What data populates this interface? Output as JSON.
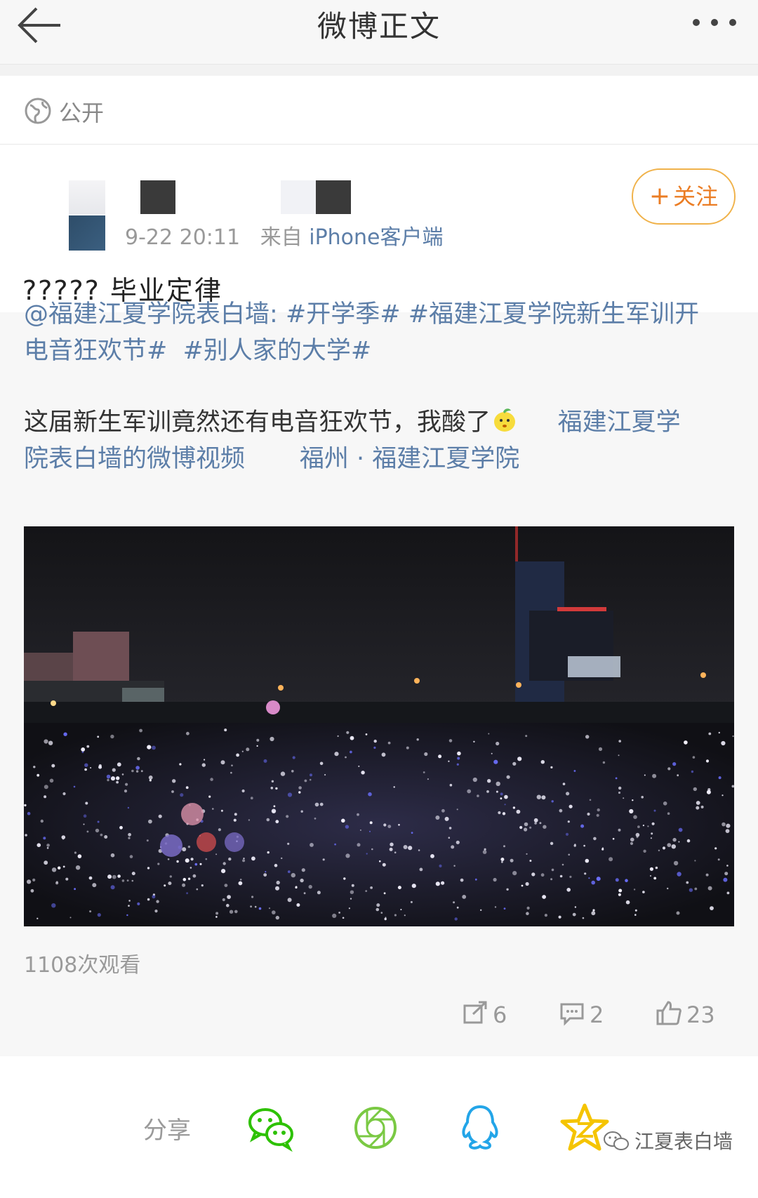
{
  "header": {
    "title": "微博正文",
    "back_icon": "arrow-left-icon",
    "more_icon": "more-dots-icon"
  },
  "visibility": {
    "icon": "globe-icon",
    "label": "公开"
  },
  "post": {
    "timestamp": "9-22 20:11",
    "source_prefix": "来自",
    "source": "iPhone客户端",
    "follow_label": "关注",
    "follow_plus": "+",
    "title": "?????  毕业定律"
  },
  "repost": {
    "mention": "@福建江夏学院表白墙",
    "colon": ":",
    "tag1": "#开学季#",
    "tag2_part1": "#福建江夏学院新生军训开",
    "tag2_part2": "电音狂欢节#",
    "tag3": "#别人家的大学#",
    "body": "这届新生军训竟然还有电音狂欢节，我酸了",
    "video_link_part1": "福建江夏学",
    "video_link_part2": "院表白墙的微博视频",
    "location": "福州 · 福建江夏学院",
    "views": "1108次观看",
    "repost_count": "6",
    "comment_count": "2",
    "like_count": "23"
  },
  "share": {
    "label": "分享",
    "icons": [
      "wechat-icon",
      "moments-icon",
      "qq-icon",
      "qzone-icon"
    ],
    "watermark": "江夏表白墙"
  },
  "colors": {
    "link_blue": "#5c7ea8",
    "follow_orange": "#eb7d24",
    "wechat_green": "#2dc100",
    "qq_blue": "#23a5e8",
    "qzone_yellow": "#f5c400"
  }
}
